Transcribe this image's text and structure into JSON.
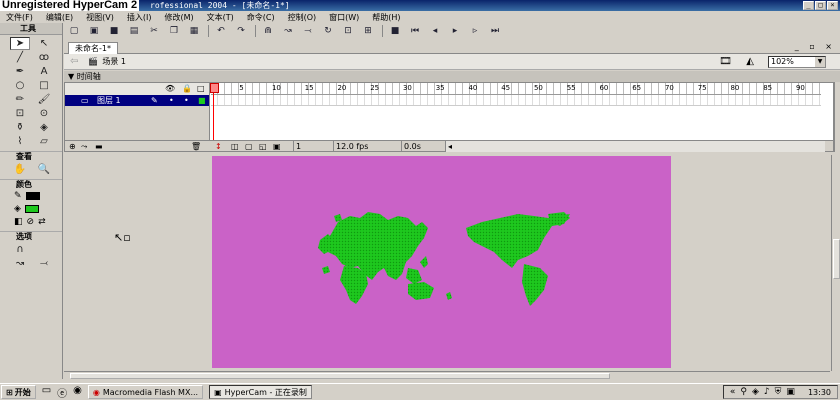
{
  "window": {
    "watermark": "Unregistered HyperCam 2",
    "title": "rofessional 2004 - [未命名-1*]",
    "controls": [
      "_",
      "□",
      "×"
    ]
  },
  "menu": [
    "文件(F)",
    "编辑(E)",
    "视图(V)",
    "插入(I)",
    "修改(M)",
    "文本(T)",
    "命令(C)",
    "控制(O)",
    "窗口(W)",
    "帮助(H)"
  ],
  "tools_panel": {
    "title": "工具",
    "view_label": "查看",
    "color_label": "颜色",
    "options_label": "选项",
    "stroke_color": "#000000",
    "fill_color": "#1ec81e"
  },
  "document": {
    "tab": "未命名-1*",
    "scene": "场景 1",
    "zoom": "102%"
  },
  "timeline": {
    "header": "▼ 时间轴",
    "ruler": [
      "1",
      "5",
      "10",
      "15",
      "20",
      "25",
      "30",
      "35",
      "40",
      "45",
      "50",
      "55",
      "60",
      "65",
      "70",
      "75",
      "80",
      "85",
      "90"
    ],
    "layer_name": "图层 1",
    "current_frame": "1",
    "fps": "12.0 fps",
    "elapsed": "0.0s"
  },
  "stage": {
    "background": "#ca62c7",
    "map_color": "#1ec81e"
  },
  "taskbar": {
    "start": "开始",
    "tasks": [
      "Macromedia Flash MX...",
      "HyperCam - 正在录制"
    ],
    "clock": "13:30"
  }
}
